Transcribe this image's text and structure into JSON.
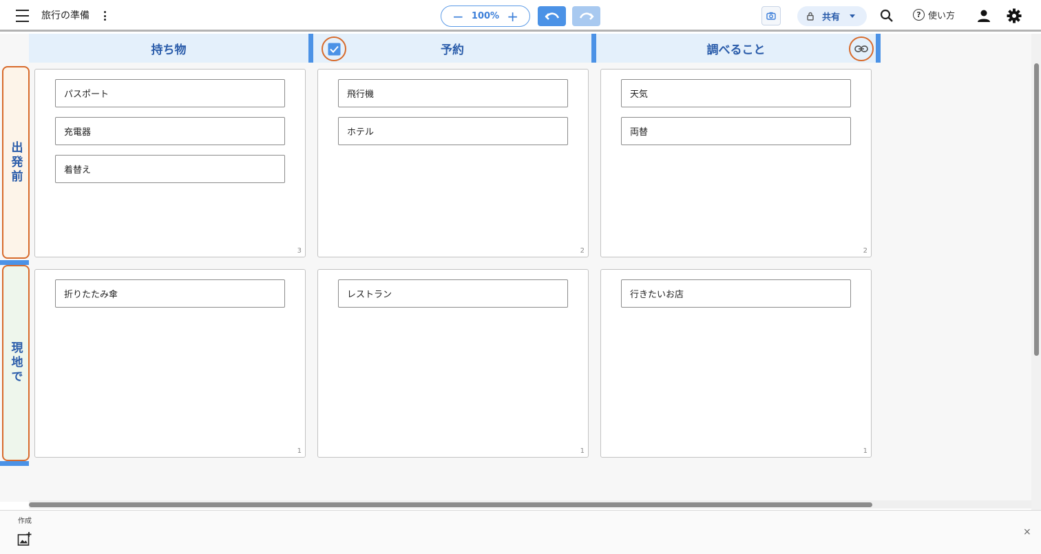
{
  "header": {
    "title": "旅行の準備",
    "zoom_level": "100%",
    "zoom_minus": "−",
    "zoom_plus": "+",
    "share_label": "共有",
    "help_label": "使い方",
    "help_glyph": "?"
  },
  "board": {
    "columns": [
      {
        "label": "持ち物"
      },
      {
        "label": "予約"
      },
      {
        "label": "調べること"
      }
    ],
    "rows": [
      {
        "label": "出発前"
      },
      {
        "label": "現地で"
      }
    ],
    "cells": [
      [
        {
          "cards": [
            "パスポート",
            "充電器",
            "着替え"
          ],
          "count": "3"
        },
        {
          "cards": [
            "飛行機",
            "ホテル"
          ],
          "count": "2"
        },
        {
          "cards": [
            "天気",
            "両替"
          ],
          "count": "2"
        }
      ],
      [
        {
          "cards": [
            "折りたたみ傘"
          ],
          "count": "1"
        },
        {
          "cards": [
            "レストラン"
          ],
          "count": "1"
        },
        {
          "cards": [
            "行きたいお店"
          ],
          "count": "1"
        }
      ]
    ]
  },
  "bottom_panel": {
    "create_label": "作成",
    "close_glyph": "×"
  },
  "colors": {
    "accent": "#4b92e6",
    "highlight": "#d86a2a",
    "header_text": "#2a5caa",
    "row1_bg": "#fdf4e9",
    "row2_bg": "#eef6ec"
  }
}
